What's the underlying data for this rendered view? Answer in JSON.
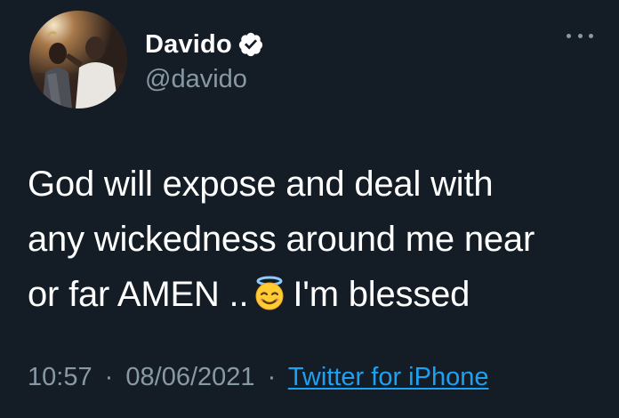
{
  "user": {
    "display_name": "Davido",
    "handle": "@davido",
    "verified": true,
    "avatar_icon": "profile-photo"
  },
  "tweet": {
    "line1": "God will expose and deal with",
    "line2": "any wickedness around me near",
    "line3_before": "or far AMEN ..",
    "emoji": "smiling-face-with-halo-icon",
    "line3_after": "I'm blessed"
  },
  "meta": {
    "time": "10:57",
    "separator": "·",
    "date": "08/06/2021",
    "source": "Twitter for iPhone"
  },
  "colors": {
    "background": "#141d26",
    "text_primary": "#ffffff",
    "text_secondary": "#8899a6",
    "link": "#1da1f2",
    "verified": "#ffffff"
  }
}
